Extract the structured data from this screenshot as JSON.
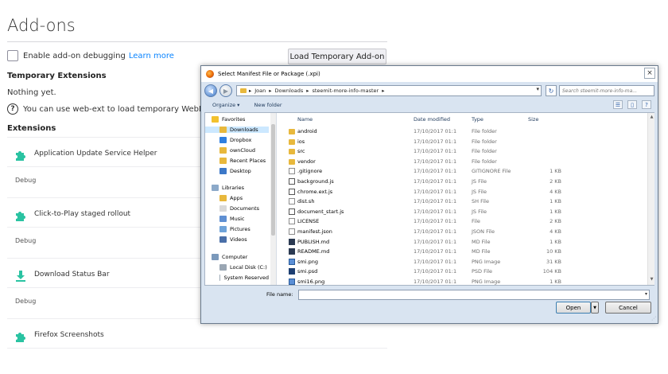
{
  "page": {
    "title": "Add-ons",
    "debugging_label": "Enable add-on debugging",
    "learn_more": "Learn more",
    "load_button": "Load Temporary Add-on",
    "temp_heading": "Temporary Extensions",
    "nothing_yet": "Nothing yet.",
    "help_text": "You can use web-ext to load temporary WebExtensions f",
    "ext_heading": "Extensions",
    "extensions": [
      {
        "name": "Application Update Service Helper",
        "debug": "Debug",
        "icon": "puzzle-icon"
      },
      {
        "name": "Click-to-Play staged rollout",
        "debug": "Debug",
        "icon": "puzzle-icon"
      },
      {
        "name": "Download Status Bar",
        "debug": "Debug",
        "icon": "download-icon"
      },
      {
        "name": "Firefox Screenshots",
        "debug": "",
        "icon": "puzzle-icon"
      }
    ],
    "colors": {
      "link": "#0a84ff",
      "addon_green": "#2ac3a2"
    }
  },
  "dialog": {
    "title": "Select Manifest File or Package (.xpi)",
    "close": "×",
    "breadcrumb": [
      "Joan",
      "Downloads",
      "steemit-more-info-master"
    ],
    "search_placeholder": "Search steemit-more-info-ma...",
    "toolbar": {
      "organize": "Organize ▾",
      "new_folder": "New folder"
    },
    "nav": [
      {
        "label": "Favorites",
        "icon": "star-icon",
        "indent": 0
      },
      {
        "label": "Downloads",
        "icon": "folder-icon",
        "indent": 1,
        "selected": true
      },
      {
        "label": "Dropbox",
        "icon": "dropbox-icon",
        "indent": 1
      },
      {
        "label": "ownCloud",
        "icon": "folder-icon",
        "indent": 1
      },
      {
        "label": "Recent Places",
        "icon": "folder-icon",
        "indent": 1
      },
      {
        "label": "Desktop",
        "icon": "desktop-icon",
        "indent": 1
      },
      {
        "label": "Libraries",
        "icon": "library-icon",
        "indent": 0
      },
      {
        "label": "Apps",
        "icon": "folder-icon",
        "indent": 1
      },
      {
        "label": "Documents",
        "icon": "documents-icon",
        "indent": 1
      },
      {
        "label": "Music",
        "icon": "music-icon",
        "indent": 1
      },
      {
        "label": "Pictures",
        "icon": "pictures-icon",
        "indent": 1
      },
      {
        "label": "Videos",
        "icon": "videos-icon",
        "indent": 1
      },
      {
        "label": "Computer",
        "icon": "computer-icon",
        "indent": 0
      },
      {
        "label": "Local Disk (C:)",
        "icon": "disk-icon",
        "indent": 1
      },
      {
        "label": "System Reserved",
        "icon": "disk-icon",
        "indent": 1
      }
    ],
    "columns": {
      "name": "Name",
      "date": "Date modified",
      "type": "Type",
      "size": "Size"
    },
    "files": [
      {
        "name": "android",
        "date": "17/10/2017 01:1",
        "type": "File folder",
        "size": "",
        "kind": "folder"
      },
      {
        "name": "ios",
        "date": "17/10/2017 01:1",
        "type": "File folder",
        "size": "",
        "kind": "folder"
      },
      {
        "name": "src",
        "date": "17/10/2017 01:1",
        "type": "File folder",
        "size": "",
        "kind": "folder"
      },
      {
        "name": "vendor",
        "date": "17/10/2017 01:1",
        "type": "File folder",
        "size": "",
        "kind": "folder"
      },
      {
        "name": ".gitignore",
        "date": "17/10/2017 01:1",
        "type": "GITIGNORE File",
        "size": "1 KB",
        "kind": "doc"
      },
      {
        "name": "background.js",
        "date": "17/10/2017 01:1",
        "type": "JS File",
        "size": "2 KB",
        "kind": "js"
      },
      {
        "name": "chrome.ext.js",
        "date": "17/10/2017 01:1",
        "type": "JS File",
        "size": "4 KB",
        "kind": "js"
      },
      {
        "name": "dist.sh",
        "date": "17/10/2017 01:1",
        "type": "SH File",
        "size": "1 KB",
        "kind": "doc"
      },
      {
        "name": "document_start.js",
        "date": "17/10/2017 01:1",
        "type": "JS File",
        "size": "1 KB",
        "kind": "js"
      },
      {
        "name": "LICENSE",
        "date": "17/10/2017 01:1",
        "type": "File",
        "size": "2 KB",
        "kind": "doc"
      },
      {
        "name": "manifest.json",
        "date": "17/10/2017 01:1",
        "type": "JSON File",
        "size": "4 KB",
        "kind": "doc"
      },
      {
        "name": "PUBLISH.md",
        "date": "17/10/2017 01:1",
        "type": "MD File",
        "size": "1 KB",
        "kind": "md"
      },
      {
        "name": "README.md",
        "date": "17/10/2017 01:1",
        "type": "MD File",
        "size": "10 KB",
        "kind": "md"
      },
      {
        "name": "smi.png",
        "date": "17/10/2017 01:1",
        "type": "PNG Image",
        "size": "31 KB",
        "kind": "img"
      },
      {
        "name": "smi.psd",
        "date": "17/10/2017 01:1",
        "type": "PSD File",
        "size": "104 KB",
        "kind": "psd"
      },
      {
        "name": "smi16.png",
        "date": "17/10/2017 01:1",
        "type": "PNG Image",
        "size": "1 KB",
        "kind": "img"
      }
    ],
    "file_name_label": "File name:",
    "file_name_value": "",
    "open_label": "Open",
    "cancel_label": "Cancel"
  }
}
